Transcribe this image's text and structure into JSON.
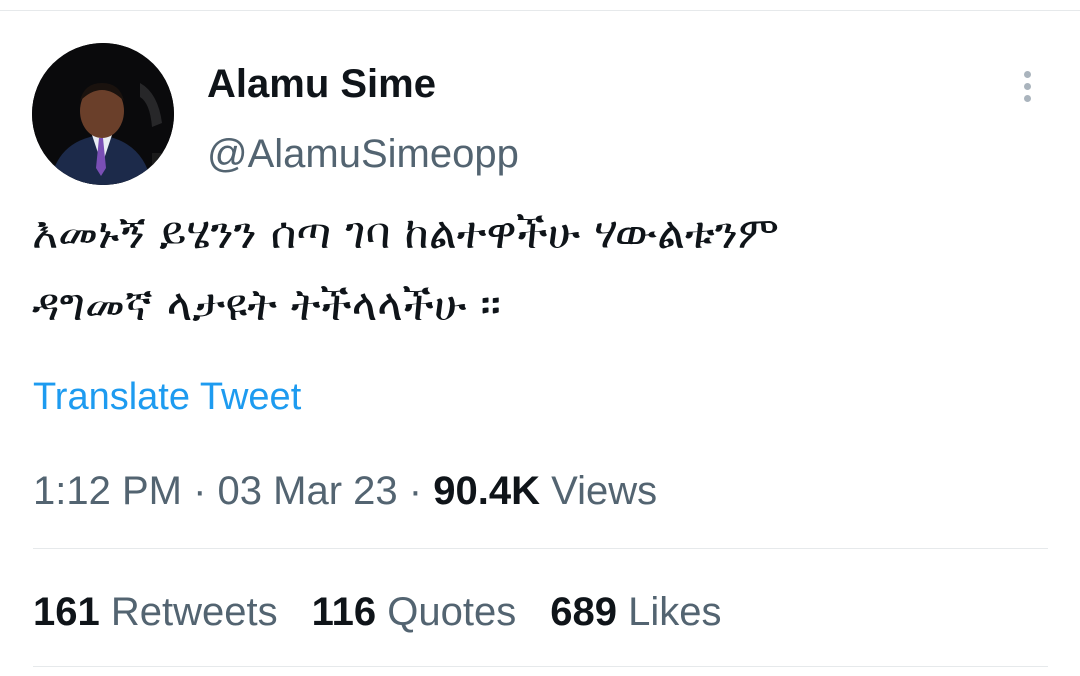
{
  "tweet": {
    "author": {
      "display_name": "Alamu Sime",
      "handle": "@AlamuSimeopp",
      "avatar_icon": "user-avatar-photo"
    },
    "more_icon": "more-vertical-icon",
    "text_lines": [
      "እመኑኝ ይሄንን ሰጣ ገባ ከልተዋችሁ ሃውልቱንም",
      "ዳግመኛ ላታዩት ትችላላችሁ ።"
    ],
    "translate_label": "Translate Tweet",
    "meta": {
      "time": "1:12 PM",
      "date": "03 Mar 23",
      "separator": "·",
      "views_count": "90.4K",
      "views_label": "Views"
    },
    "stats": {
      "retweets_count": "161",
      "retweets_label": "Retweets",
      "quotes_count": "116",
      "quotes_label": "Quotes",
      "likes_count": "689",
      "likes_label": "Likes"
    }
  },
  "colors": {
    "text_primary": "#0f1419",
    "text_secondary": "#536471",
    "link": "#1d9bf0",
    "divider": "#e6e9eb"
  }
}
